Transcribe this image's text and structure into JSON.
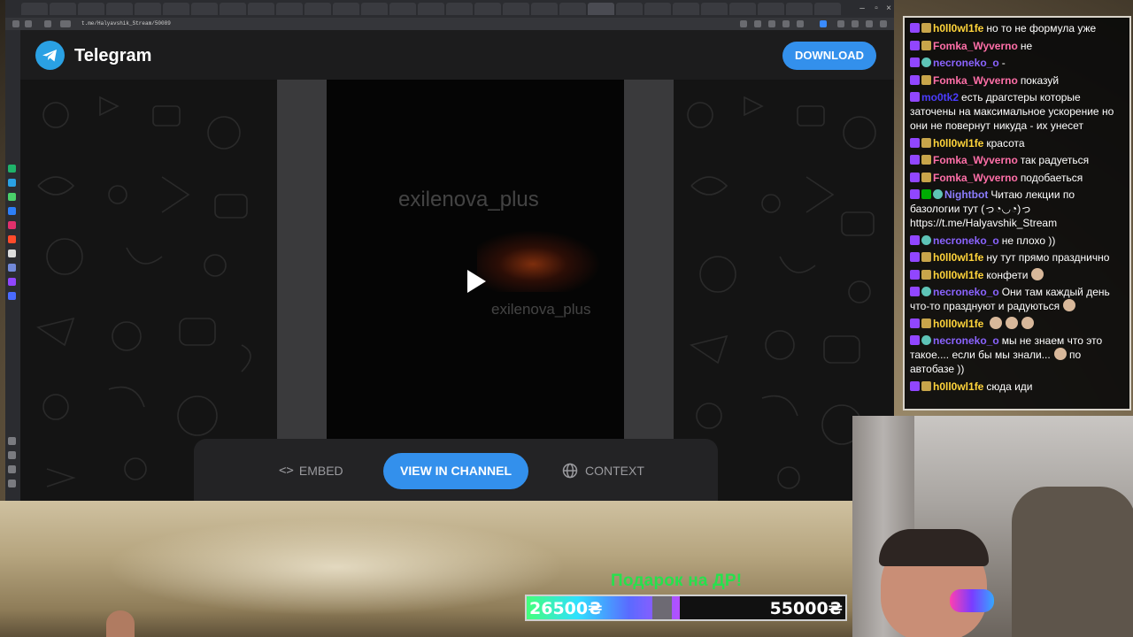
{
  "browser": {
    "url": "t.me/Halyavshik_Stream/50089"
  },
  "telegram": {
    "title": "Telegram",
    "download_label": "DOWNLOAD",
    "watermark_top": "exilenova_plus",
    "watermark_bottom": "exilenova_plus",
    "embed_label": "EMBED",
    "embed_icon": "<>",
    "view_in_channel_label": "VIEW IN CHANNEL",
    "context_label": "CONTEXT",
    "accent": "#3390ec"
  },
  "chat": {
    "messages": [
      {
        "name": "h0ll0wl1fe",
        "color": "#ffd43b",
        "badges": [
          "twitch",
          "gift"
        ],
        "text": "но то не формула уже"
      },
      {
        "name": "Fomka_Wyverno",
        "color": "#ff6fa8",
        "badges": [
          "twitch",
          "gift"
        ],
        "text": "не"
      },
      {
        "name": "necroneko_o",
        "color": "#8a63ff",
        "badges": [
          "twitch",
          "face"
        ],
        "text": "-"
      },
      {
        "name": "Fomka_Wyverno",
        "color": "#ff6fa8",
        "badges": [
          "twitch",
          "gift"
        ],
        "text": "показуй"
      },
      {
        "name": "mo0tk2",
        "color": "#4b3cff",
        "badges": [
          "twitch"
        ],
        "text": "есть драгстеры которые заточены на максимальное ускорение но они не повернут никуда - их унесет"
      },
      {
        "name": "h0ll0wl1fe",
        "color": "#ffd43b",
        "badges": [
          "twitch",
          "gift"
        ],
        "text": "красота"
      },
      {
        "name": "Fomka_Wyverno",
        "color": "#ff6fa8",
        "badges": [
          "twitch",
          "gift"
        ],
        "text": "так радуеться"
      },
      {
        "name": "Fomka_Wyverno",
        "color": "#ff6fa8",
        "badges": [
          "twitch",
          "gift"
        ],
        "text": "подобаеться"
      },
      {
        "name": "Nightbot",
        "color": "#8c7dff",
        "badges": [
          "twitch",
          "mod",
          "face"
        ],
        "text": "Читаю лекции по базологии тут (っ◔◡◔)っ https://t.me/Halyavshik_Stream"
      },
      {
        "name": "necroneko_o",
        "color": "#8a63ff",
        "badges": [
          "twitch",
          "face"
        ],
        "text": "не плохо ))"
      },
      {
        "name": "h0ll0wl1fe",
        "color": "#ffd43b",
        "badges": [
          "twitch",
          "gift"
        ],
        "text": "ну тут прямо празднично"
      },
      {
        "name": "h0ll0wl1fe",
        "color": "#ffd43b",
        "badges": [
          "twitch",
          "gift"
        ],
        "text": "конфети",
        "emotes": 1
      },
      {
        "name": "necroneko_o",
        "color": "#8a63ff",
        "badges": [
          "twitch",
          "face"
        ],
        "text": "Они там каждый день что-то празднуют и радуються",
        "emotes": 1
      },
      {
        "name": "h0ll0wl1fe",
        "color": "#ffd43b",
        "badges": [
          "twitch",
          "gift"
        ],
        "text": "",
        "emotes": 3
      },
      {
        "name": "necroneko_o",
        "color": "#8a63ff",
        "badges": [
          "twitch",
          "face"
        ],
        "text": "мы не знаем что это такое.... если бы мы знали...",
        "emotes": 1,
        "text_after": " по автобазе ))"
      },
      {
        "name": "h0ll0wl1fe",
        "color": "#ffd43b",
        "badges": [
          "twitch",
          "gift"
        ],
        "text": "сюда иди"
      }
    ]
  },
  "goal": {
    "title": "Подарок на ДР!",
    "current": "26500₴",
    "target": "55000₴",
    "progress_fraction": 0.48
  },
  "icons": {
    "telegram": "telegram-logo-icon",
    "play": "play-icon",
    "globe": "globe-icon"
  }
}
